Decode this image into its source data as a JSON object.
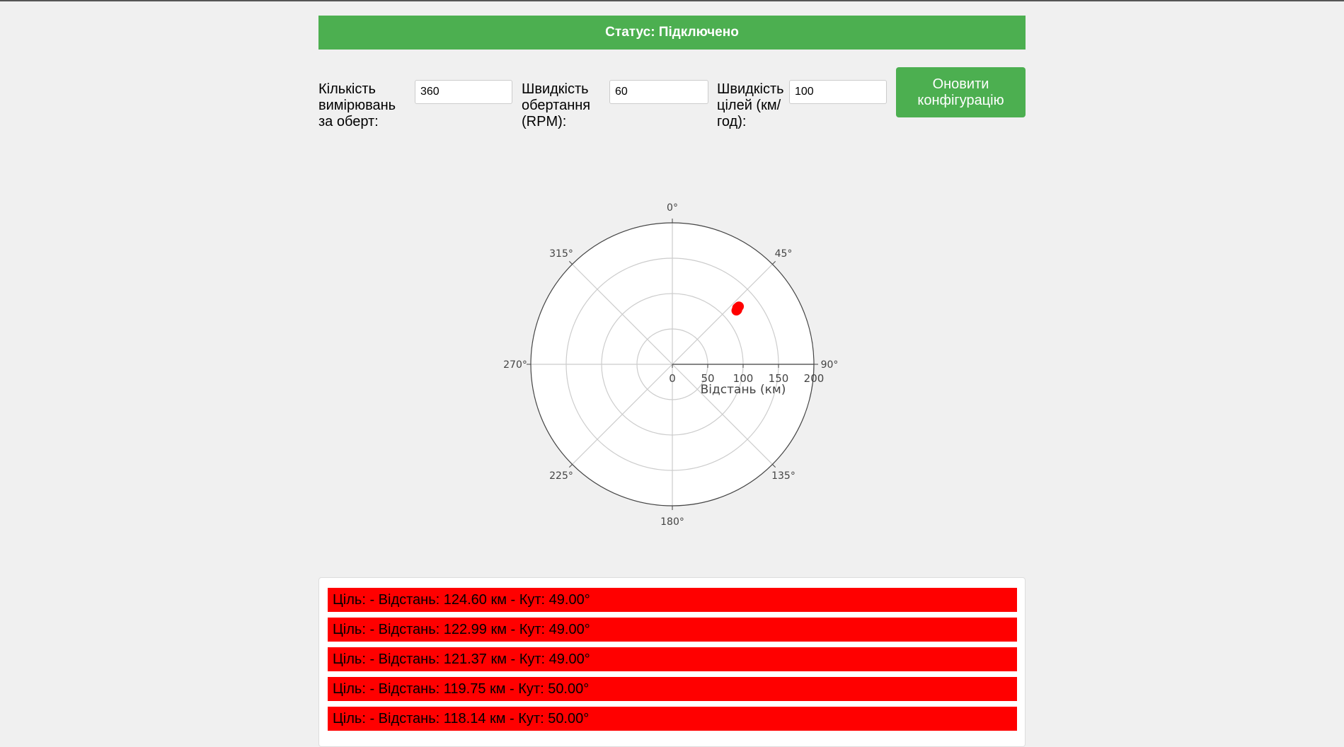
{
  "status": {
    "text": "Статус: Підключено"
  },
  "config": {
    "measurements_label": "Кількість вимірювань за оберт:",
    "measurements_value": "360",
    "rpm_label": "Швидкість обертання (RPM):",
    "rpm_value": "60",
    "target_speed_label": "Швидкість цілей (км/год):",
    "target_speed_value": "100",
    "update_button": "Оновити конфігурацію"
  },
  "chart_data": {
    "type": "scatter",
    "coordinate_system": "polar",
    "angular_ticks": [
      "0°",
      "45°",
      "90°",
      "135°",
      "180°",
      "225°",
      "270°",
      "315°"
    ],
    "radial_ticks": [
      "0",
      "50",
      "100",
      "150",
      "200"
    ],
    "radial_label": "Відстань (км)",
    "radial_range": [
      0,
      200
    ],
    "angular_direction": "clockwise",
    "angular_zero": "top",
    "grid": true,
    "marker_color": "#ff0000",
    "series": [
      {
        "points": [
          {
            "r": 124.6,
            "theta": 49.0
          },
          {
            "r": 122.99,
            "theta": 49.0
          },
          {
            "r": 121.37,
            "theta": 49.0
          },
          {
            "r": 119.75,
            "theta": 50.0
          },
          {
            "r": 118.14,
            "theta": 50.0
          }
        ]
      }
    ]
  },
  "targets": [
    {
      "text": "Ціль: - Відстань: 124.60 км - Кут: 49.00°"
    },
    {
      "text": "Ціль: - Відстань: 122.99 км - Кут: 49.00°"
    },
    {
      "text": "Ціль: - Відстань: 121.37 км - Кут: 49.00°"
    },
    {
      "text": "Ціль: - Відстань: 119.75 км - Кут: 50.00°"
    },
    {
      "text": "Ціль: - Відстань: 118.14 км - Кут: 50.00°"
    }
  ]
}
